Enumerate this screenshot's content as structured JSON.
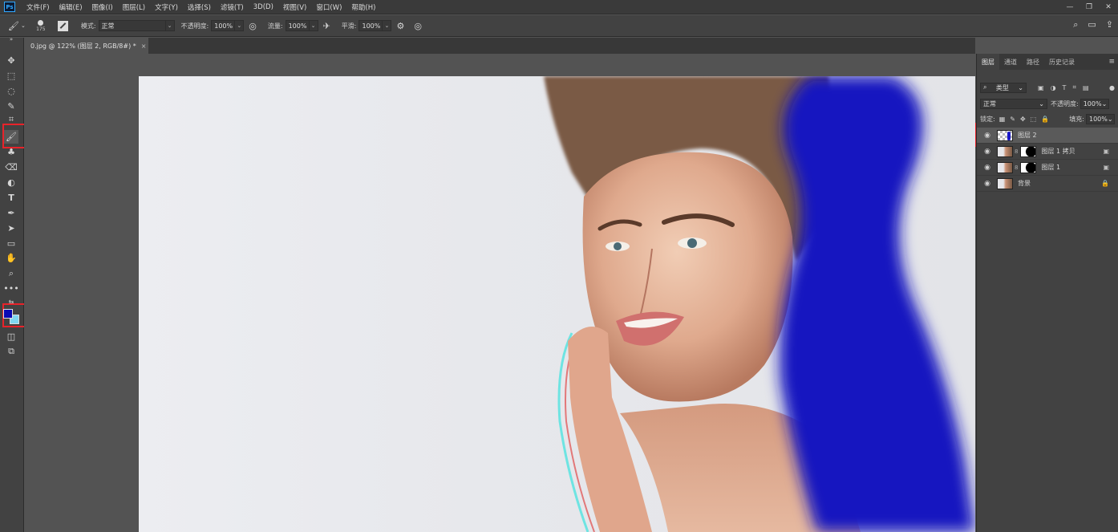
{
  "app": {
    "logo_text": "Ps"
  },
  "menu": [
    "文件(F)",
    "编辑(E)",
    "图像(I)",
    "图层(L)",
    "文字(Y)",
    "选择(S)",
    "滤镜(T)",
    "3D(D)",
    "视图(V)",
    "窗口(W)",
    "帮助(H)"
  ],
  "window_controls": {
    "minimize": "—",
    "restore": "❐",
    "close": "✕"
  },
  "options_bar": {
    "brush_size": "175",
    "mode_label": "模式:",
    "mode_value": "正常",
    "opacity_label": "不透明度:",
    "opacity_value": "100%",
    "flow_label": "流量:",
    "flow_value": "100%",
    "smoothing_label": "平滑:",
    "smoothing_value": "100%"
  },
  "document": {
    "tab_title": "0.jpg @ 122% (图层 2, RGB/8#) *",
    "close": "×"
  },
  "colors": {
    "foreground": "#0a0ab4",
    "background": "#7fd6f0",
    "highlight": "#e8232a",
    "paint_blue": "#1414c0"
  },
  "panel": {
    "tabs": [
      "图层",
      "通道",
      "路径",
      "历史记录"
    ],
    "filter_label": "类型",
    "blend_mode": "正常",
    "opacity_label": "不透明度:",
    "opacity_value": "100%",
    "lock_label": "锁定:",
    "fill_label": "填充:",
    "fill_value": "100%",
    "layers": [
      {
        "name": "图层 2",
        "selected": true
      },
      {
        "name": "图层 1 拷贝",
        "selected": false
      },
      {
        "name": "图层 1",
        "selected": false
      },
      {
        "name": "背景",
        "selected": false
      }
    ]
  }
}
